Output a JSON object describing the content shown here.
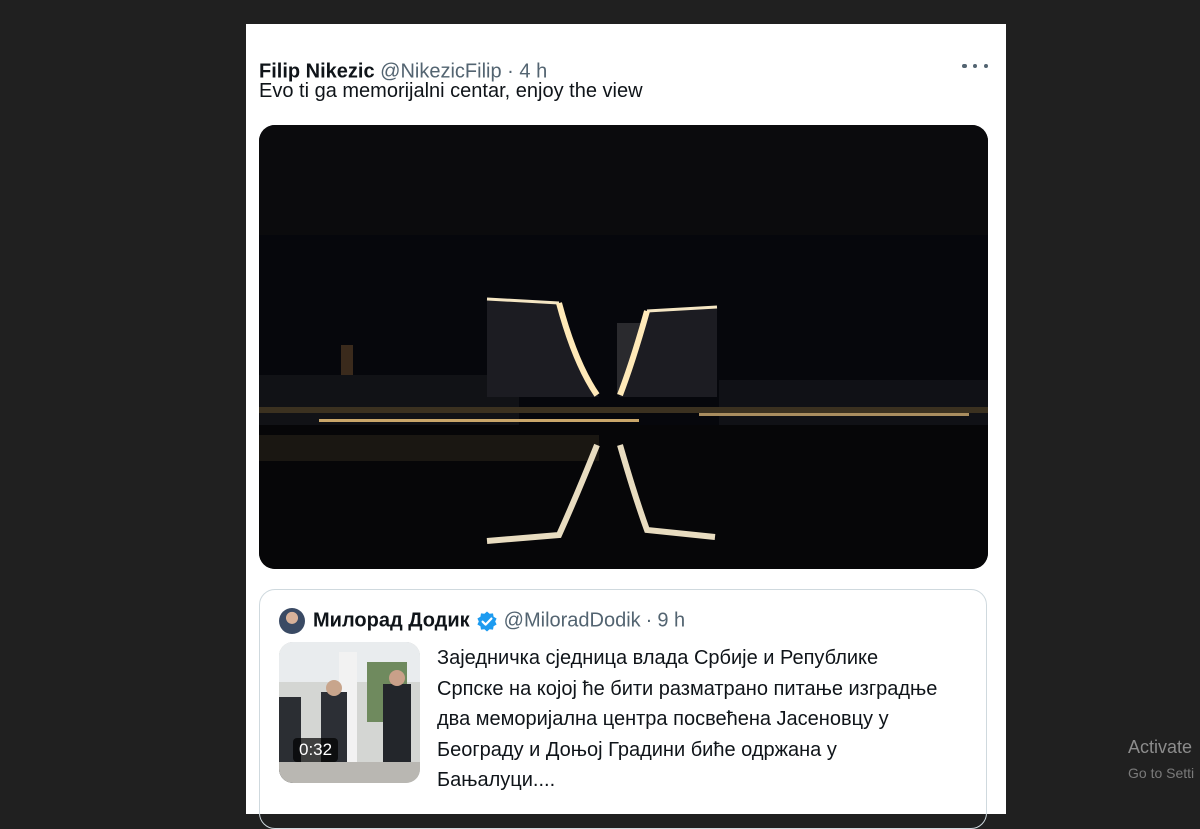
{
  "tweet": {
    "author_name": "Filip Nikezic",
    "author_handle": "@NikezicFilip",
    "separator": "·",
    "time": "4 h",
    "text": "Evo ti ga memorijalni centar, enjoy the view",
    "more_icon": "ellipsis-icon"
  },
  "quoted_tweet": {
    "author_name": "Милорад Додик",
    "author_handle": "@MiloradDodik",
    "separator": "·",
    "time": "9 h",
    "verified_icon": "verified-badge-icon",
    "video_duration": "0:32",
    "text_lines": [
      "Заједничка сједница влада Србије и Републике",
      "Српске на којој ће бити разматрано питање изградње",
      "два меморијална центра посвећена Јасеновцу у",
      "Београду и Доњој Градини биће одржана у",
      "Бањалуци...."
    ]
  },
  "colors": {
    "background": "#202020",
    "card": "#ffffff",
    "text": "#0f1419",
    "secondary_text": "#536471",
    "verified": "#1d9bf0",
    "border": "#cfd9de"
  },
  "os_watermark": {
    "line1": "Activate",
    "line2": "Go to Setti"
  }
}
